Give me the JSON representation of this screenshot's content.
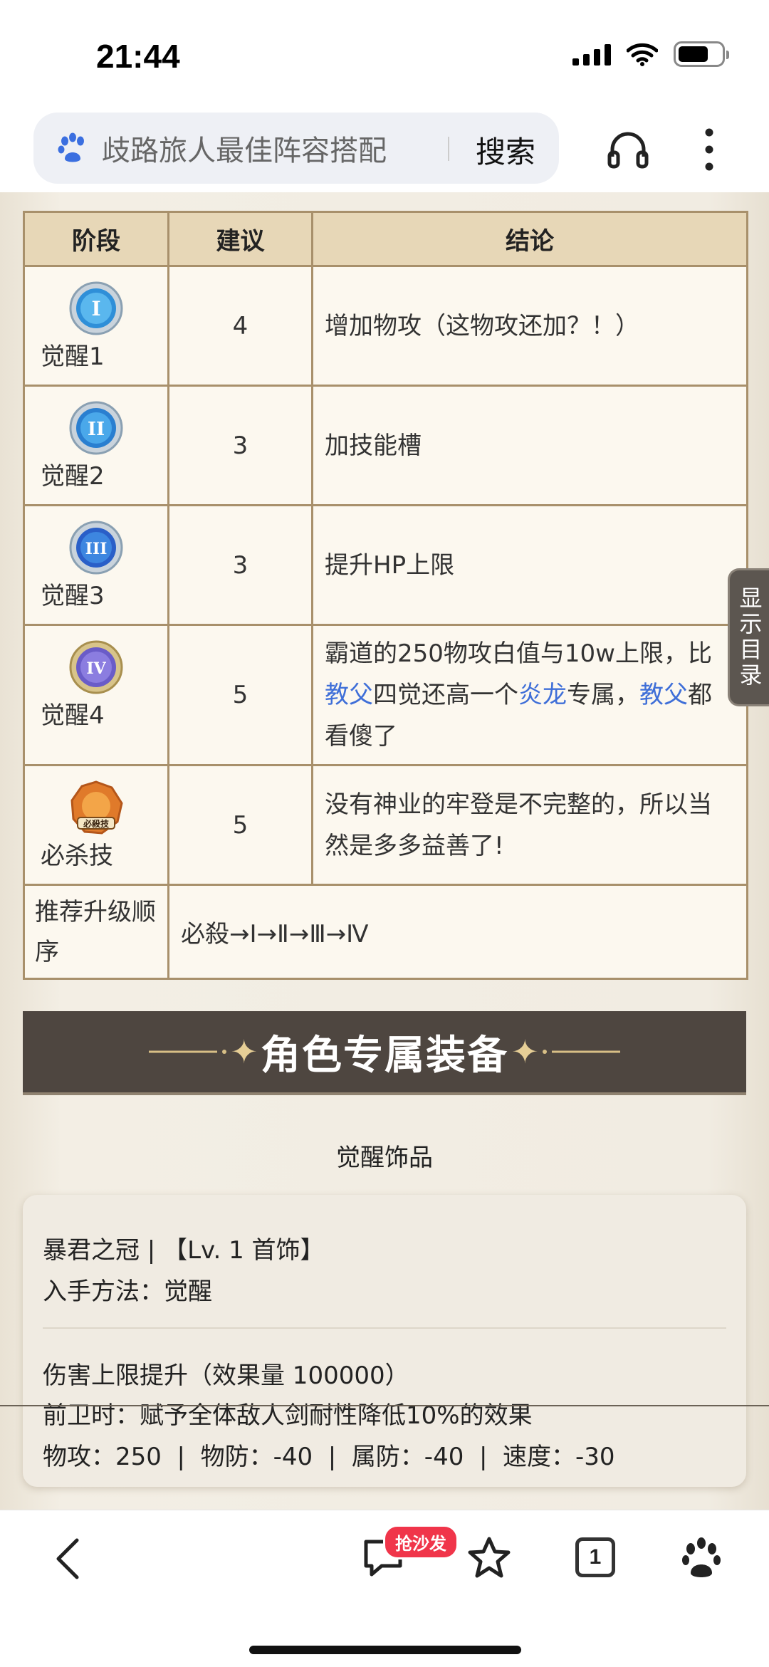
{
  "status_bar": {
    "time": "21:44"
  },
  "search": {
    "query": "歧路旅人最佳阵容搭配",
    "button_label": "搜索"
  },
  "table": {
    "headers": [
      "阶段",
      "建议",
      "结论"
    ],
    "rows": [
      {
        "medal": "awakening-1",
        "stage": "觉醒1",
        "rec": "4",
        "conclusion": "增加物攻（这物攻还加？！）"
      },
      {
        "medal": "awakening-2",
        "stage": "觉醒2",
        "rec": "3",
        "conclusion": "加技能槽"
      },
      {
        "medal": "awakening-3",
        "stage": "觉醒3",
        "rec": "3",
        "conclusion": "提升HP上限"
      },
      {
        "medal": "awakening-4",
        "stage": "觉醒4",
        "rec": "5",
        "conclusion_parts": [
          "霸道的250物攻白值与10w上限，比",
          "教父",
          "四觉还高一个",
          "炎龙",
          "专属，",
          "教父",
          "都看傻了"
        ]
      },
      {
        "medal": "ultimate-skill",
        "medal_text": "必殺技",
        "stage": "必杀技",
        "rec": "5",
        "conclusion": "没有神业的牢登是不完整的，所以当然是多多益善了!"
      }
    ],
    "order_label": "推荐升级顺序",
    "order_value": "必殺→Ⅰ→Ⅱ→Ⅲ→Ⅳ"
  },
  "section": {
    "banner_title": "角色专属装备",
    "sub_title": "觉醒饰品"
  },
  "equipment": {
    "name": "暴君之冠 | 【Lv. 1 首饰】",
    "method": "入手方法：觉醒",
    "effect_1": "伤害上限提升（效果量 100000）",
    "effect_2": "前卫时：赋予全体敌人剑耐性降低10%的效果",
    "stats": "物攻：250  |  物防：-40  |  属防：-40  |  速度：-30"
  },
  "toc_tab": {
    "label": "显示目录"
  },
  "bottom_nav": {
    "hot_badge": "抢沙发",
    "tab_count": "1"
  },
  "colors": {
    "link": "#3f6fd8",
    "banner": "#4e4640",
    "table_border": "#a8906b",
    "header_fill": "#e7d7b7",
    "badge": "#f0354a"
  }
}
